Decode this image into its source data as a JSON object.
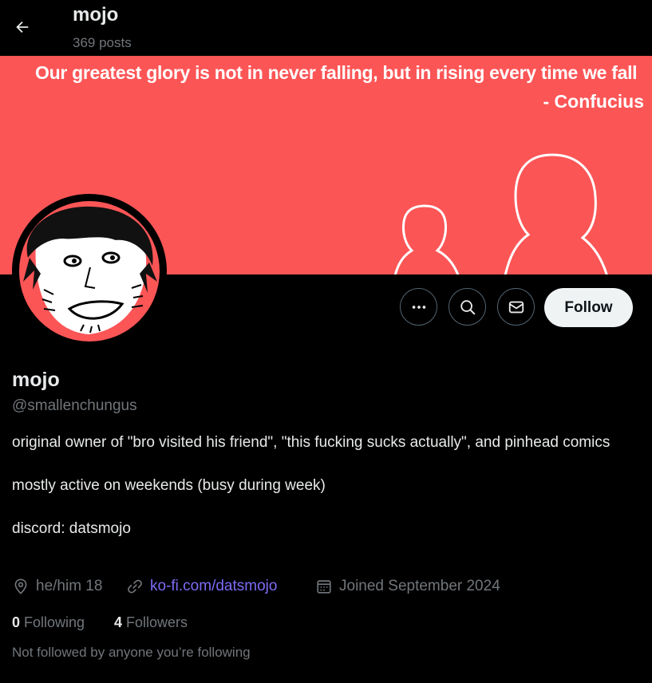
{
  "header": {
    "name": "mojo",
    "posts": "369 posts"
  },
  "banner": {
    "quote_line1": "Our greatest glory is not in never falling, but in rising every time we fall",
    "quote_line2": "- Confucius",
    "background_color": "#fc5556"
  },
  "actions": {
    "more_icon": "more-dots-icon",
    "search_icon": "search-icon",
    "message_icon": "envelope-icon",
    "follow_label": "Follow"
  },
  "profile": {
    "display_name": "mojo",
    "handle": "@smallenchungus",
    "bio": [
      "original owner of \"bro visited his friend\", \"this fucking sucks actually\", and pinhead comics",
      "mostly active on weekends (busy during week)",
      "discord: datsmojo"
    ],
    "location": "he/him 18",
    "website": "ko-fi.com/datsmojo",
    "joined": "Joined September 2024"
  },
  "stats": {
    "following_count": "0",
    "following_label": "Following",
    "followers_count": "4",
    "followers_label": "Followers"
  },
  "social_context": "Not followed by anyone you’re following"
}
